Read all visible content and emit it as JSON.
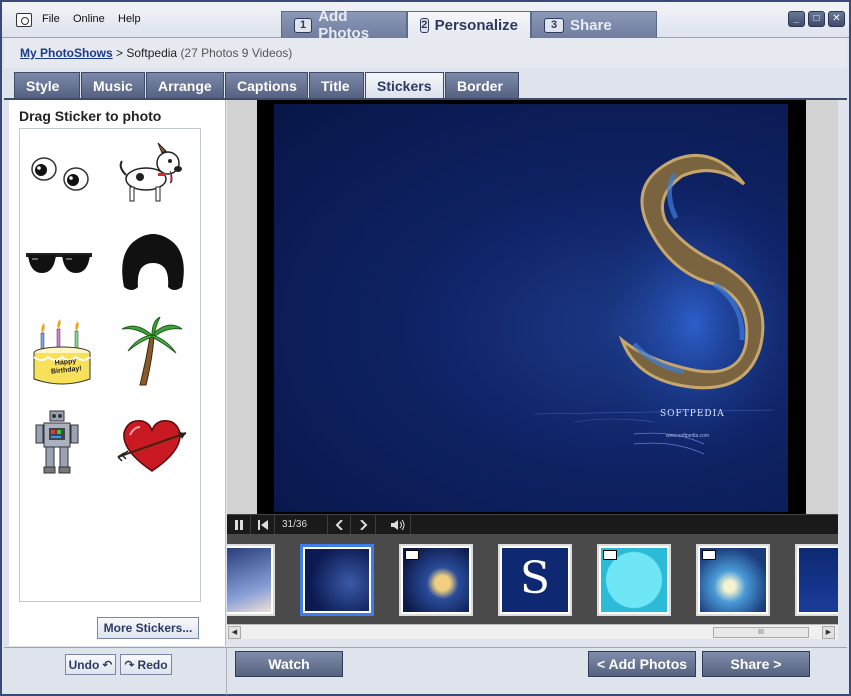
{
  "menu": [
    "File",
    "Online",
    "Help"
  ],
  "steps": [
    {
      "num": "1",
      "label": "Add Photos"
    },
    {
      "num": "2",
      "label": "Personalize"
    },
    {
      "num": "3",
      "label": "Share"
    }
  ],
  "window_buttons": {
    "minimize": "_",
    "maximize": "□",
    "close": "✕"
  },
  "breadcrumb": {
    "link": "My PhotoShows",
    "separator": ">",
    "current": "Softpedia",
    "count": "(27 Photos 9 Videos)"
  },
  "tabs": [
    "Style",
    "Music",
    "Arrange",
    "Captions",
    "Title",
    "Stickers",
    "Border"
  ],
  "active_tab": "Stickers",
  "left_panel": {
    "title": "Drag Sticker to photo",
    "stickers": [
      "googly-eyes",
      "dog",
      "sunglasses",
      "afro-wig",
      "birthday-cake",
      "palm-tree",
      "robot",
      "heart-arrow"
    ],
    "cake_text": "Happy Birthday!",
    "more_button": "More Stickers..."
  },
  "preview": {
    "watermark": "SOFTPEDIA",
    "url": "www.softpedia.com"
  },
  "transport": {
    "counter": "31/36"
  },
  "scroll_grip": "III",
  "bottom": {
    "undo": "Undo",
    "redo": "Redo",
    "watch": "Watch",
    "add_photos": "< Add Photos",
    "share": "Share >"
  },
  "colors": {
    "accent": "#3f7ee8",
    "tab_active_text": "#2b3b62",
    "dark_blue": "#0f2366"
  }
}
